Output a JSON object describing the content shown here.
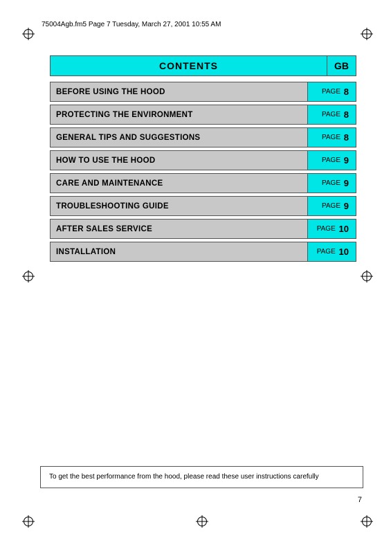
{
  "header": {
    "meta_text": "75004Agb.fm5  Page 7  Tuesday, March 27, 2001  10:55 AM"
  },
  "contents": {
    "title": "CONTENTS",
    "gb_label": "GB"
  },
  "toc_rows": [
    {
      "label": "BEFORE USING THE HOOD",
      "page_word": "PAGE",
      "page_num": "8"
    },
    {
      "label": "PROTECTING THE ENVIRONMENT",
      "page_word": "PAGE",
      "page_num": "8"
    },
    {
      "label": "GENERAL TIPS AND SUGGESTIONS",
      "page_word": "PAGE",
      "page_num": "8"
    },
    {
      "label": "HOW TO USE THE HOOD",
      "page_word": "PAGE",
      "page_num": "9"
    },
    {
      "label": "CARE AND MAINTENANCE",
      "page_word": "PAGE",
      "page_num": "9"
    },
    {
      "label": "TROUBLESHOOTING GUIDE",
      "page_word": "PAGE",
      "page_num": "9"
    },
    {
      "label": "AFTER SALES SERVICE",
      "page_word": "PAGE",
      "page_num": "10"
    },
    {
      "label": "INSTALLATION",
      "page_word": "PAGE",
      "page_num": "10"
    }
  ],
  "bottom_note": "To get the best performance from the hood, please read these user instructions carefully",
  "page_number": "7"
}
